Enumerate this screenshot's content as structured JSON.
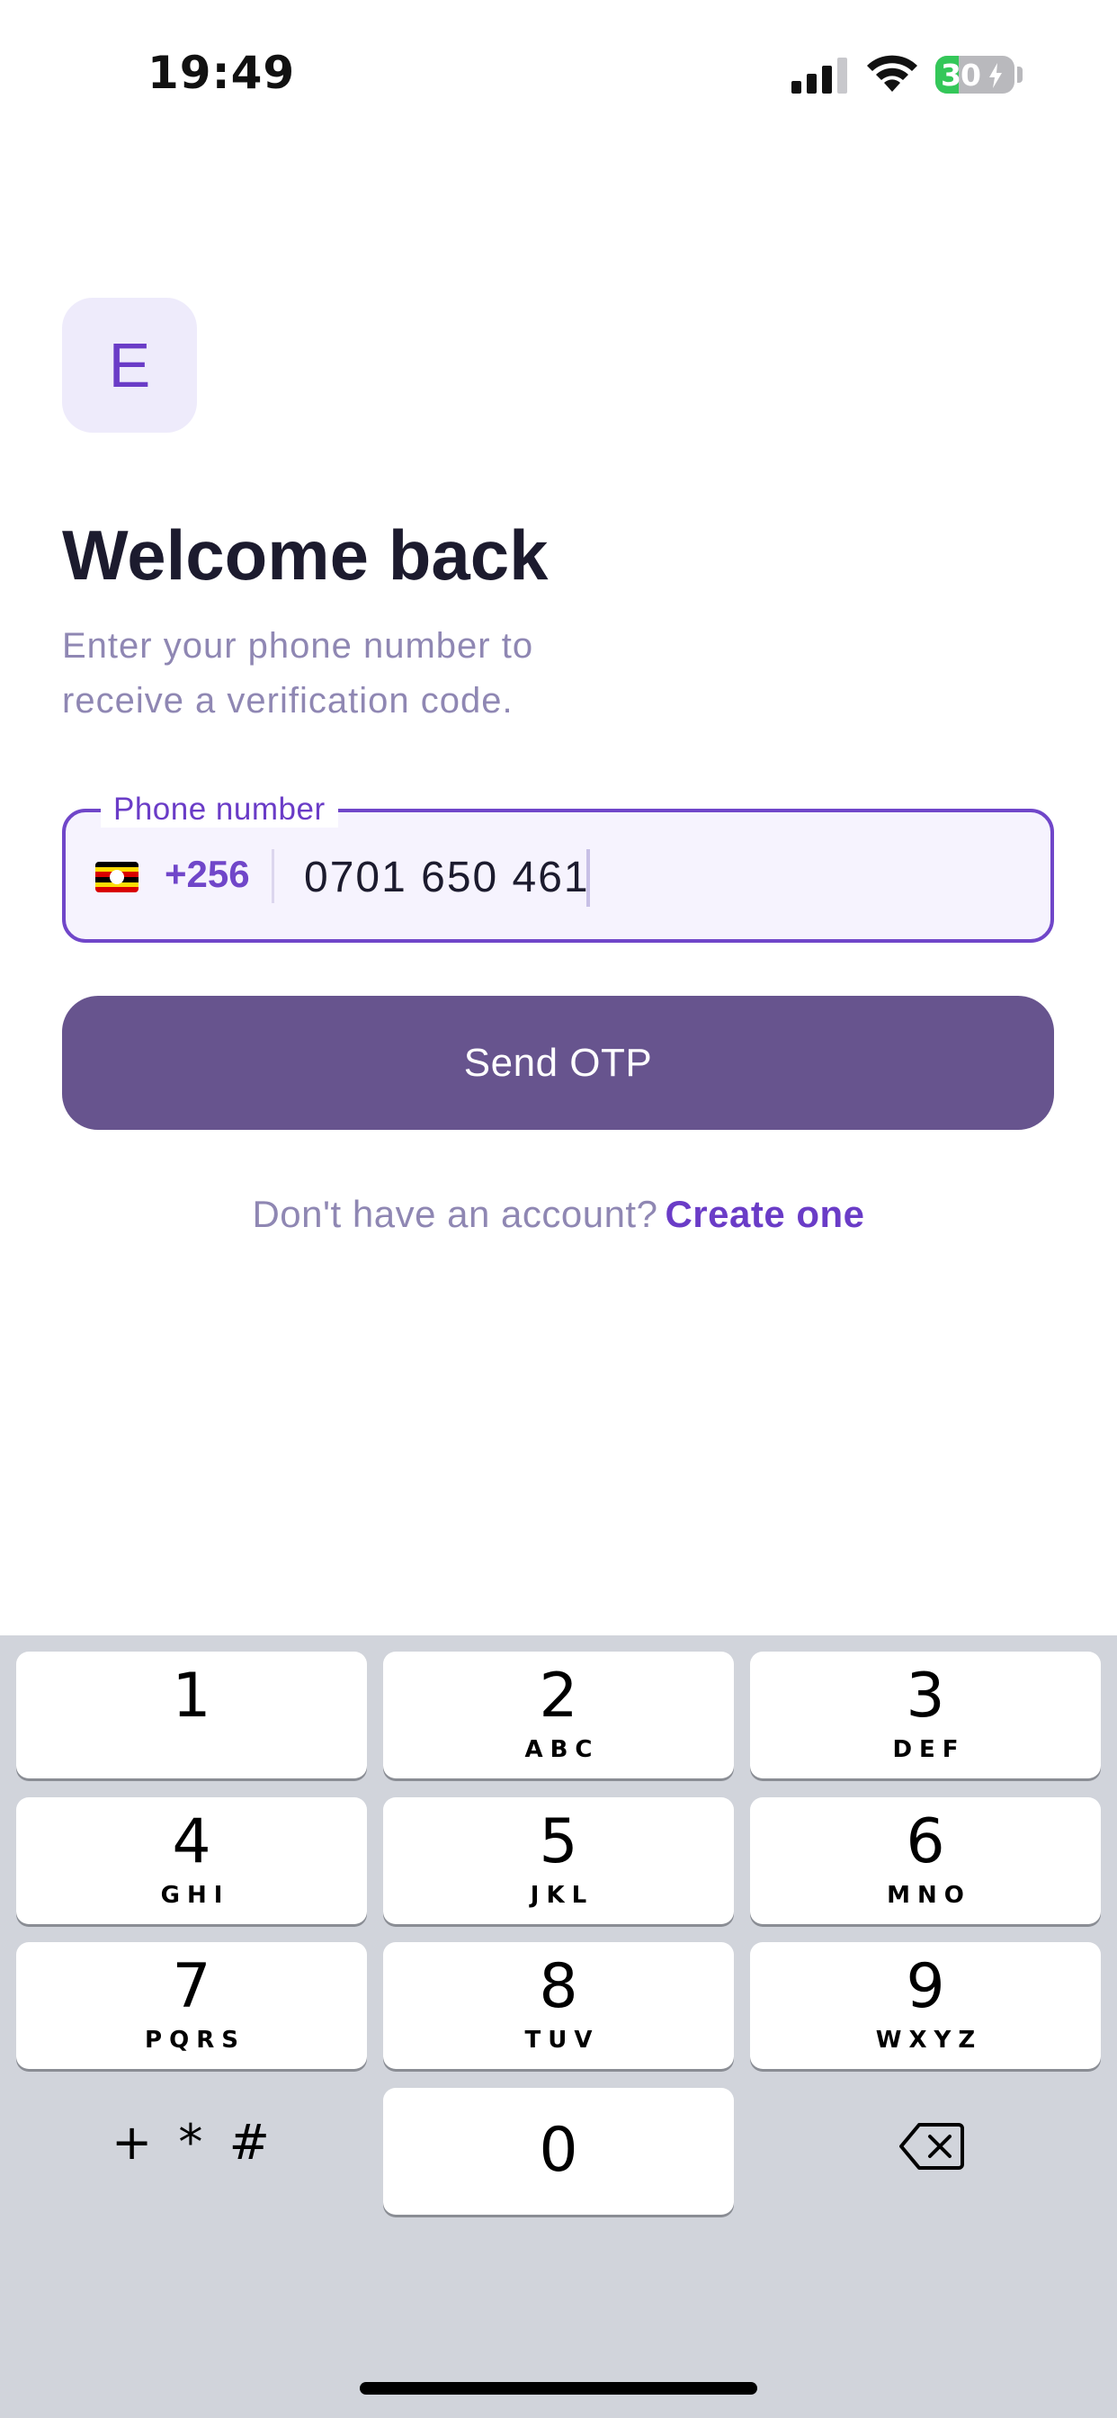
{
  "status_bar": {
    "time": "19:49",
    "battery_level": "30",
    "battery_fraction": 0.3,
    "icons": [
      "cellular-signal-icon",
      "wifi-icon",
      "battery-charging-icon"
    ]
  },
  "logo": {
    "letter": "E",
    "accent_color": "#6a3cc7",
    "tile_color": "#eeebfb"
  },
  "header": {
    "title": "Welcome back",
    "subtitle": "Enter your phone number to receive a verification code."
  },
  "phone_field": {
    "label": "Phone number",
    "flag_icon": "uganda-flag-icon",
    "country_code": "+256",
    "value": "0701 650 461"
  },
  "send_button": {
    "label": "Send OTP",
    "color": "#67548e"
  },
  "signup": {
    "prompt": "Don't have an account?",
    "link": "Create one"
  },
  "keyboard": {
    "keys": [
      {
        "digit": "1",
        "letters": ""
      },
      {
        "digit": "2",
        "letters": "ABC"
      },
      {
        "digit": "3",
        "letters": "DEF"
      },
      {
        "digit": "4",
        "letters": "GHI"
      },
      {
        "digit": "5",
        "letters": "JKL"
      },
      {
        "digit": "6",
        "letters": "MNO"
      },
      {
        "digit": "7",
        "letters": "PQRS"
      },
      {
        "digit": "8",
        "letters": "TUV"
      },
      {
        "digit": "9",
        "letters": "WXYZ"
      },
      {
        "digit": "0",
        "letters": ""
      }
    ],
    "symbols_key": "+ * #",
    "delete_icon": "backspace-icon"
  }
}
